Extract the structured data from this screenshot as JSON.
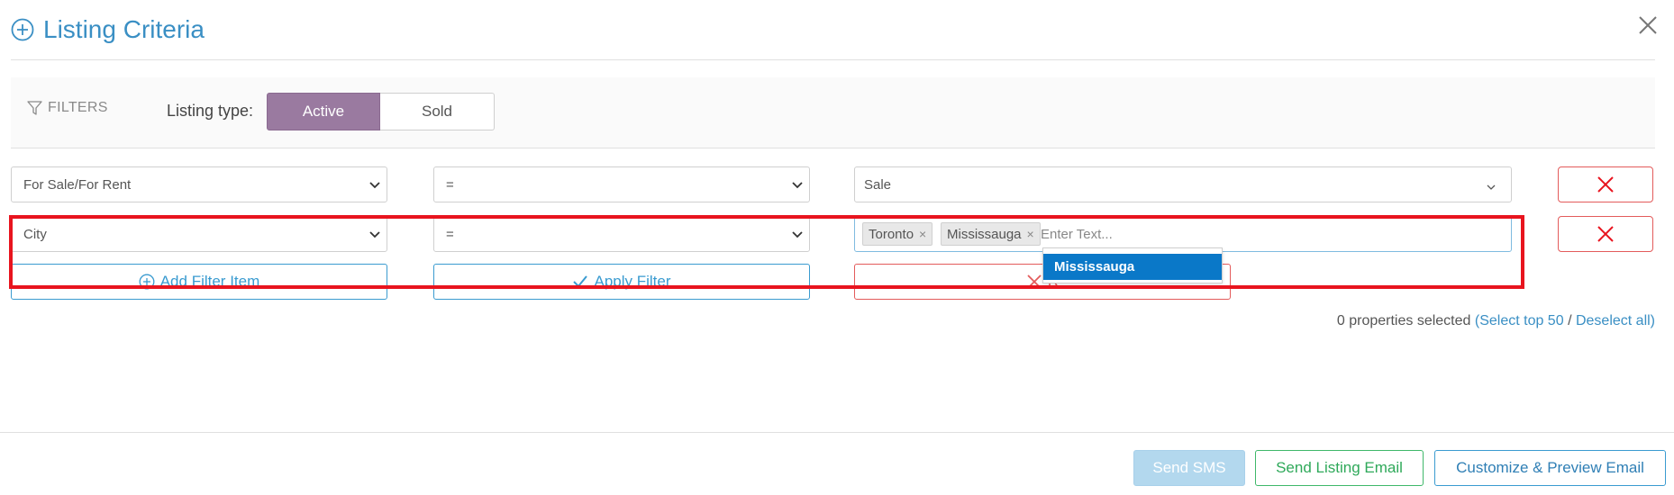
{
  "modal": {
    "title": "Listing Criteria",
    "title_icon": "plus-circle-icon",
    "close_icon": "close-icon"
  },
  "filters": {
    "label": "FILTERS",
    "icon": "funnel-icon",
    "listing_type_label": "Listing type:",
    "listing_type_options": [
      "Active",
      "Sold"
    ],
    "listing_type_selected": "Active",
    "active_color": "#9a7aa0"
  },
  "filter_rows": [
    {
      "field": "For Sale/For Rent",
      "operator": "=",
      "value": "Sale"
    },
    {
      "field": "City",
      "operator": "=",
      "tags": [
        "Toronto",
        "Mississauga"
      ],
      "placeholder": "Enter Text..."
    }
  ],
  "autocomplete": {
    "options": [
      "Mississauga"
    ],
    "highlighted": "Mississauga",
    "highlight_color": "#0a78c8"
  },
  "actions": {
    "add_filter": "Add Filter Item",
    "apply_filter": "Apply Filter",
    "reset": "R"
  },
  "selection": {
    "count_text": "0 properties selected",
    "open_paren": "(",
    "select_top": "Select top 50",
    "separator": "/",
    "deselect_all": "Deselect all)"
  },
  "footer": {
    "send_sms": "Send SMS",
    "send_listing_email": "Send Listing Email",
    "customize_preview": "Customize & Preview Email"
  },
  "colors": {
    "primary_blue": "#3a9bd0",
    "danger_red": "#e35b5b",
    "success_green": "#2fa95a",
    "highlight_red": "#e8141e"
  }
}
